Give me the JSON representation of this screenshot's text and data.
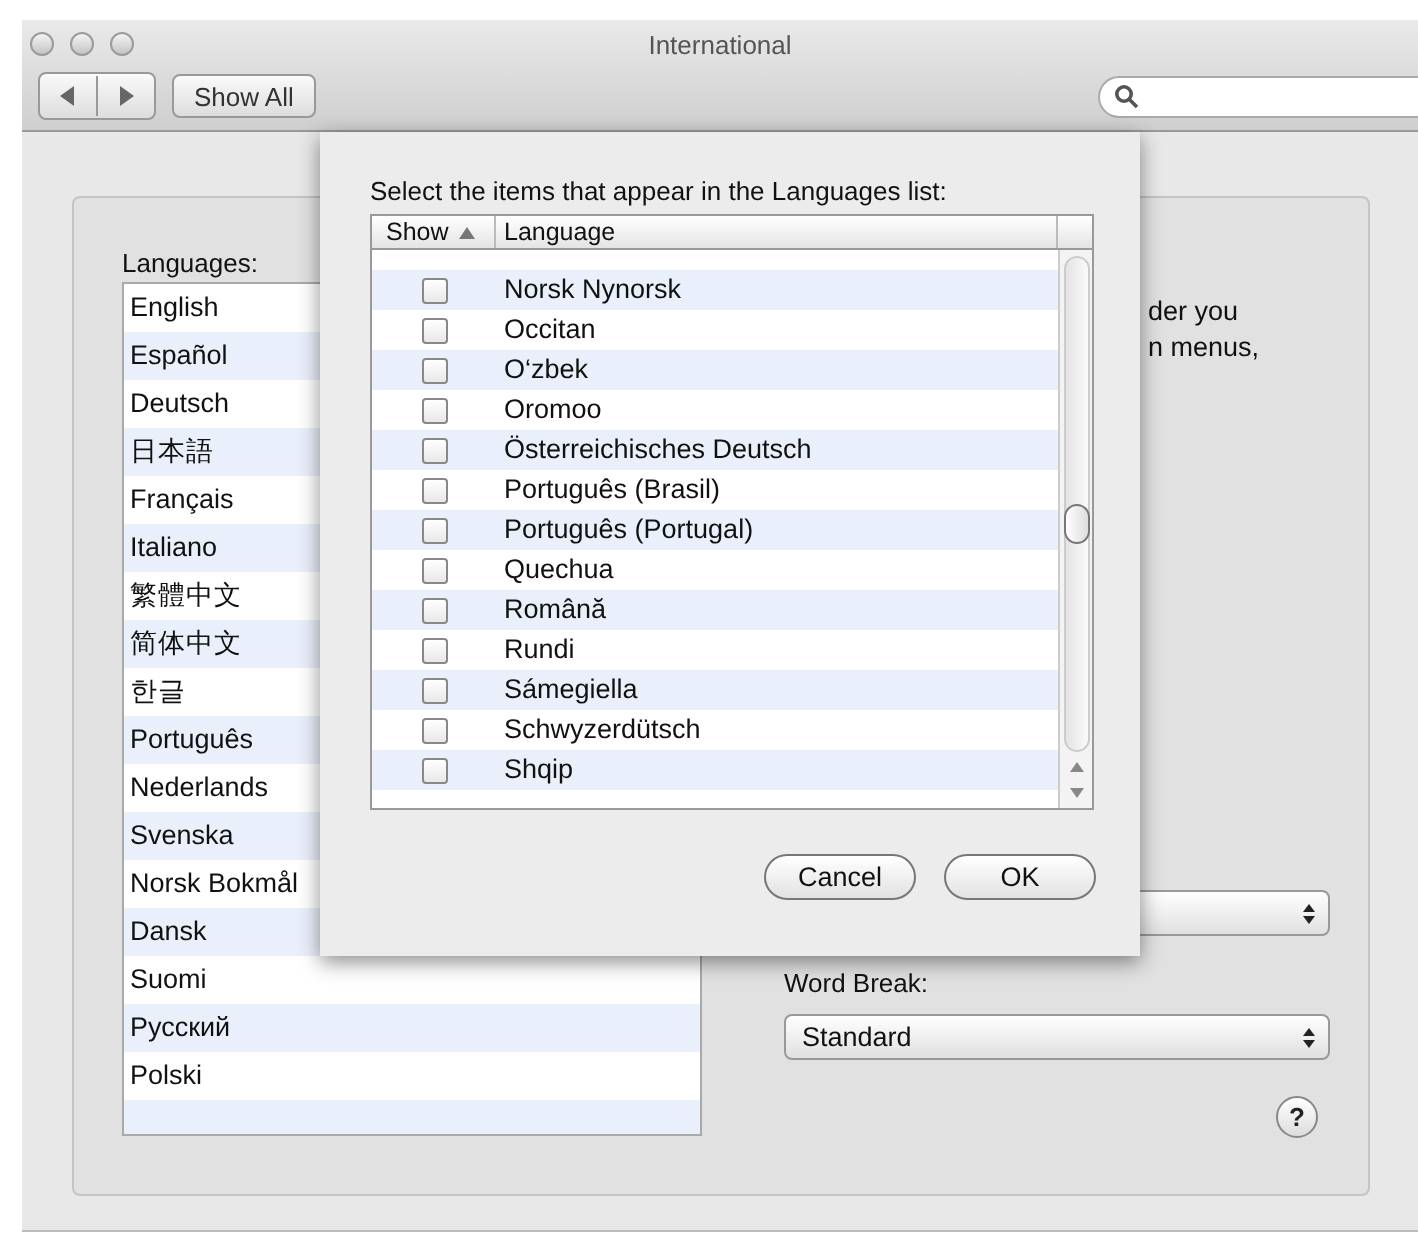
{
  "window": {
    "title": "International"
  },
  "toolbar": {
    "show_all": "Show All"
  },
  "languages": {
    "label": "Languages:",
    "items": [
      "English",
      "Español",
      "Deutsch",
      "日本語",
      "Français",
      "Italiano",
      "繁體中文",
      "简体中文",
      "한글",
      "Português",
      "Nederlands",
      "Svenska",
      "Norsk Bokmål",
      "Dansk",
      "Suomi",
      "Русский",
      "Polski"
    ]
  },
  "description_lines": [
    "der you",
    "n menus,"
  ],
  "word_break": {
    "label": "Word Break:",
    "value": "Standard"
  },
  "help": {
    "label": "?"
  },
  "sheet": {
    "prompt": "Select the items that appear in the Languages list:",
    "columns": [
      {
        "label": "Show",
        "sorted": true
      },
      {
        "label": "Language",
        "sorted": false
      }
    ],
    "rows": [
      {
        "label": "Norsk Nynorsk",
        "checked": false
      },
      {
        "label": "Occitan",
        "checked": false
      },
      {
        "label": "O‘zbek",
        "checked": false
      },
      {
        "label": "Oromoo",
        "checked": false
      },
      {
        "label": "Österreichisches Deutsch",
        "checked": false
      },
      {
        "label": "Português (Brasil)",
        "checked": false
      },
      {
        "label": "Português (Portugal)",
        "checked": false
      },
      {
        "label": "Quechua",
        "checked": false
      },
      {
        "label": "Română",
        "checked": false
      },
      {
        "label": "Rundi",
        "checked": false
      },
      {
        "label": "Sámegiella",
        "checked": false
      },
      {
        "label": "Schwyzerdütsch",
        "checked": false
      },
      {
        "label": "Shqip",
        "checked": false
      }
    ],
    "buttons": [
      "Cancel",
      "OK"
    ]
  }
}
